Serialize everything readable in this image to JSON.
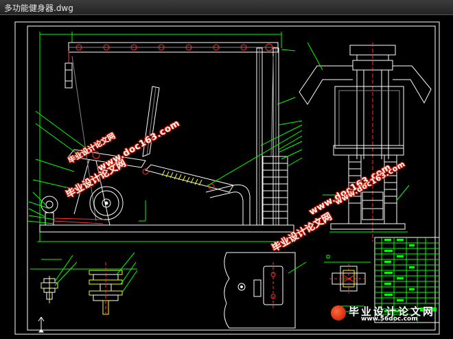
{
  "window": {
    "title": "多功能健身器.dwg"
  },
  "colors": {
    "background": "#000000",
    "line": "#ffffff",
    "dimension": "#00ff00",
    "accent": "#ff3030",
    "highlight": "#ffff00"
  },
  "watermarks": [
    {
      "text": "毕业设计论文网"
    },
    {
      "text": "www.doc163.com"
    },
    {
      "text": "毕业设计论文网"
    },
    {
      "text": "www.doc163.com"
    },
    {
      "text": "毕业设计论文网"
    },
    {
      "text": "www.doc163.com"
    }
  ],
  "brand": {
    "name": "毕业设计论文网",
    "url": "www.56doc.com",
    "icon": "logo-icon"
  },
  "drawings": [
    {
      "name": "side-view"
    },
    {
      "name": "front-view"
    },
    {
      "name": "pulley-detail"
    },
    {
      "name": "plate-detail"
    },
    {
      "name": "shaft-detail"
    },
    {
      "name": "title-block"
    }
  ]
}
